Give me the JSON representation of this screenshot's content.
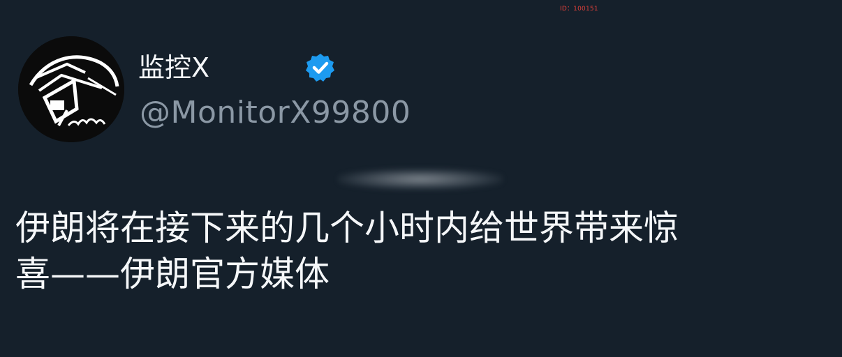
{
  "watermark": {
    "id_text": "ID：100151"
  },
  "author": {
    "display_name": "监控X",
    "handle": "@MonitorX99800",
    "verified": true,
    "verified_color": "#1d9bf0",
    "avatar_icon": "hooded-figure-avatar"
  },
  "tweet": {
    "line1": "伊朗将在接下来的几个小时内给世界带来惊",
    "line2": "喜——伊朗官方媒体"
  },
  "colors": {
    "background": "#15202b",
    "text_primary": "#f5f7f9",
    "text_secondary": "#8b98a5"
  }
}
